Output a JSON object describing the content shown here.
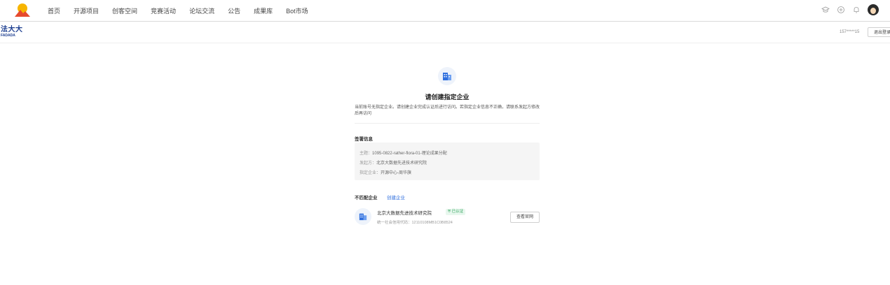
{
  "nav": {
    "items": [
      "首页",
      "开源项目",
      "创客空间",
      "竞赛活动",
      "论坛交流",
      "公告",
      "成果库",
      "Bot市场"
    ]
  },
  "top_icons": [
    "graduation-cap-icon",
    "plus-circle-icon",
    "bell-icon"
  ],
  "brand": {
    "cn": "法大大",
    "en": "FADADA",
    "color": "#1a3c8f"
  },
  "header": {
    "phone": "157*****15",
    "logout_label": "退出登录"
  },
  "card": {
    "title": "请创建指定企业",
    "description": "当前账号无指定企业。请创建企业完成认证后进行访问。若指定企业信息不正确，请联系发起方修改后再访问",
    "signing_info_label": "签署信息",
    "info": {
      "subject_key": "主题：",
      "subject_val": "1095-0822-rather-flora-01-理论成果分配",
      "initiator_key": "发起方：",
      "initiator_val": "北京大数据先进技术研究院",
      "enterprise_key": "指定企业：",
      "enterprise_val": "开源中心-周华旗"
    },
    "mismatch_label": "不匹配企业",
    "create_link": "创建企业",
    "enterprise": {
      "name": "北京大数据先进技术研究院",
      "verified": "已认证",
      "code": "统一社会信用代码：12110108MB1C0B8524",
      "view_label": "查看官网"
    }
  },
  "colors": {
    "accent": "#2f6fde",
    "verified": "#2ea35a"
  }
}
